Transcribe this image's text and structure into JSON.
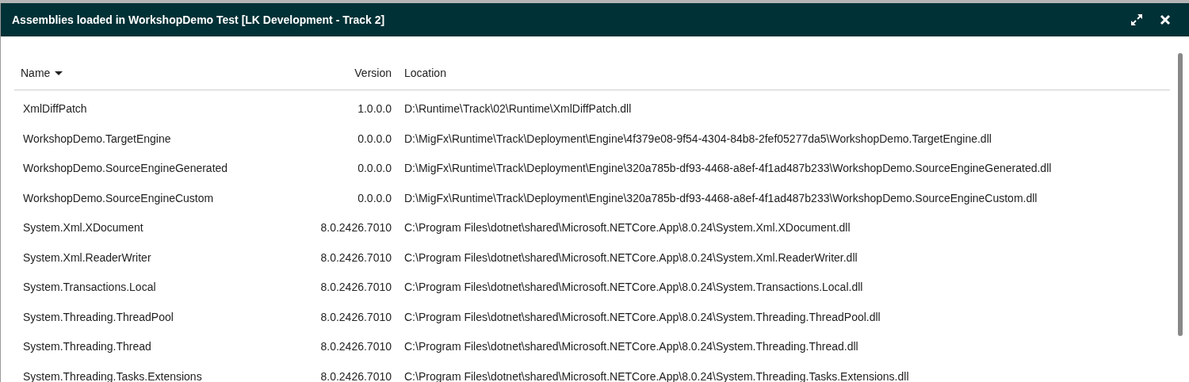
{
  "dialog": {
    "title": "Assemblies loaded in WorkshopDemo Test [LK Development - Track 2]"
  },
  "table": {
    "columns": [
      {
        "label": "Name",
        "sorted": true,
        "kind": "text"
      },
      {
        "label": "Version",
        "sorted": false,
        "kind": "number"
      },
      {
        "label": "Location",
        "sorted": false,
        "kind": "text"
      }
    ],
    "rows": [
      [
        "XmlDiffPatch",
        "1.0.0.0",
        "D:\\Runtime\\Track\\02\\Runtime\\XmlDiffPatch.dll"
      ],
      [
        "WorkshopDemo.TargetEngine",
        "0.0.0.0",
        "D:\\MigFx\\Runtime\\Track\\Deployment\\Engine\\4f379e08-9f54-4304-84b8-2fef05277da5\\WorkshopDemo.TargetEngine.dll"
      ],
      [
        "WorkshopDemo.SourceEngineGenerated",
        "0.0.0.0",
        "D:\\MigFx\\Runtime\\Track\\Deployment\\Engine\\320a785b-df93-4468-a8ef-4f1ad487b233\\WorkshopDemo.SourceEngineGenerated.dll"
      ],
      [
        "WorkshopDemo.SourceEngineCustom",
        "0.0.0.0",
        "D:\\MigFx\\Runtime\\Track\\Deployment\\Engine\\320a785b-df93-4468-a8ef-4f1ad487b233\\WorkshopDemo.SourceEngineCustom.dll"
      ],
      [
        "System.Xml.XDocument",
        "8.0.2426.7010",
        "C:\\Program Files\\dotnet\\shared\\Microsoft.NETCore.App\\8.0.24\\System.Xml.XDocument.dll"
      ],
      [
        "System.Xml.ReaderWriter",
        "8.0.2426.7010",
        "C:\\Program Files\\dotnet\\shared\\Microsoft.NETCore.App\\8.0.24\\System.Xml.ReaderWriter.dll"
      ],
      [
        "System.Transactions.Local",
        "8.0.2426.7010",
        "C:\\Program Files\\dotnet\\shared\\Microsoft.NETCore.App\\8.0.24\\System.Transactions.Local.dll"
      ],
      [
        "System.Threading.ThreadPool",
        "8.0.2426.7010",
        "C:\\Program Files\\dotnet\\shared\\Microsoft.NETCore.App\\8.0.24\\System.Threading.ThreadPool.dll"
      ],
      [
        "System.Threading.Thread",
        "8.0.2426.7010",
        "C:\\Program Files\\dotnet\\shared\\Microsoft.NETCore.App\\8.0.24\\System.Threading.Thread.dll"
      ],
      [
        "System.Threading.Tasks.Extensions",
        "8.0.2426.7010",
        "C:\\Program Files\\dotnet\\shared\\Microsoft.NETCore.App\\8.0.24\\System.Threading.Tasks.Extensions.dll"
      ]
    ]
  }
}
